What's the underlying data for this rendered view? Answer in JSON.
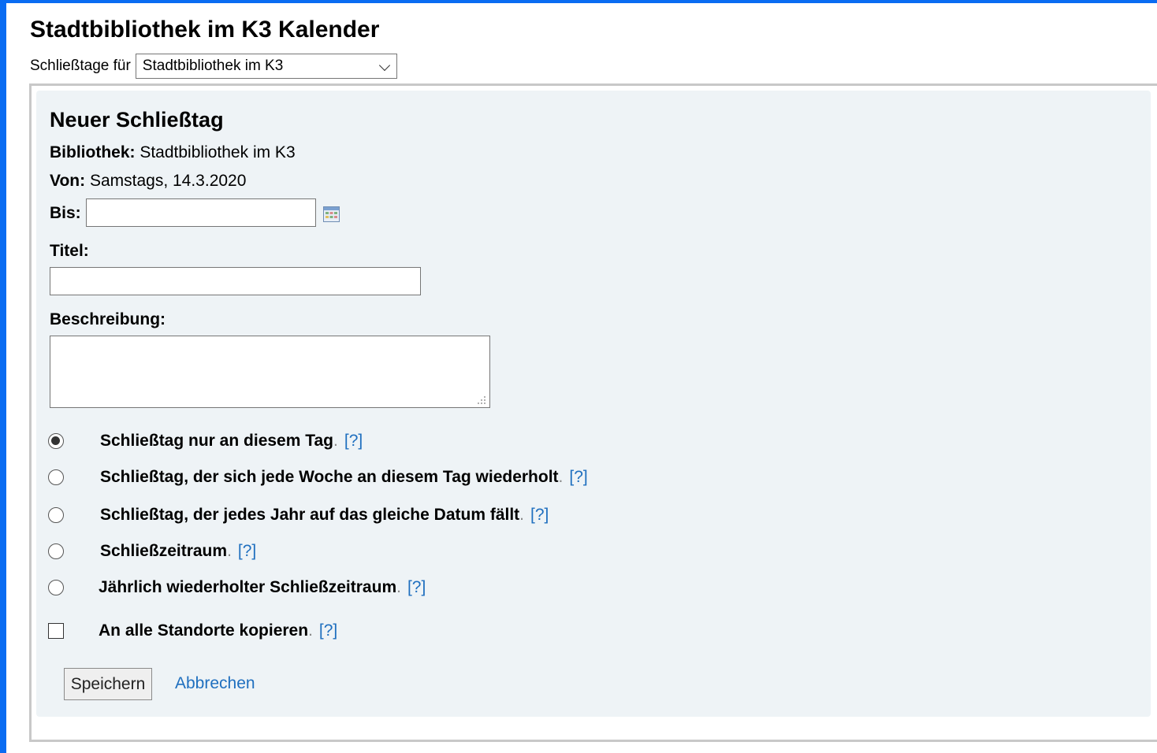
{
  "page": {
    "title": "Stadtbibliothek im K3 Kalender",
    "branch_label": "Schließtage für",
    "branch_selected": "Stadtbibliothek im K3"
  },
  "form": {
    "heading": "Neuer Schließtag",
    "library_label": "Bibliothek:",
    "library_value": "Stadtbibliothek im K3",
    "from_label": "Von:",
    "from_value": "Samstags, 14.3.2020",
    "to_label": "Bis:",
    "to_value": "",
    "title_label": "Titel:",
    "title_value": "",
    "description_label": "Beschreibung:",
    "description_value": "",
    "options": [
      {
        "label": "Schließtag nur an diesem Tag",
        "checked": true
      },
      {
        "label": "Schließtag, der sich jede Woche an diesem Tag wiederholt",
        "checked": false
      },
      {
        "label": "Schließtag, der jedes Jahr auf das gleiche Datum fällt",
        "checked": false
      },
      {
        "label": "Schließzeitraum",
        "checked": false
      },
      {
        "label": "Jährlich wiederholter Schließzeitraum",
        "checked": false
      }
    ],
    "copy_all_label": "An alle Standorte kopieren",
    "copy_all_checked": false,
    "help_text": "[?]",
    "separator": ".",
    "save_label": "Speichern",
    "cancel_label": "Abbrechen"
  },
  "icons": {
    "calendar": "calendar-icon",
    "dropdown": "chevron-down-icon"
  },
  "colors": {
    "frame": "#0a6cf2",
    "panel_bg": "#eef3f6",
    "link": "#1f6fbf"
  }
}
